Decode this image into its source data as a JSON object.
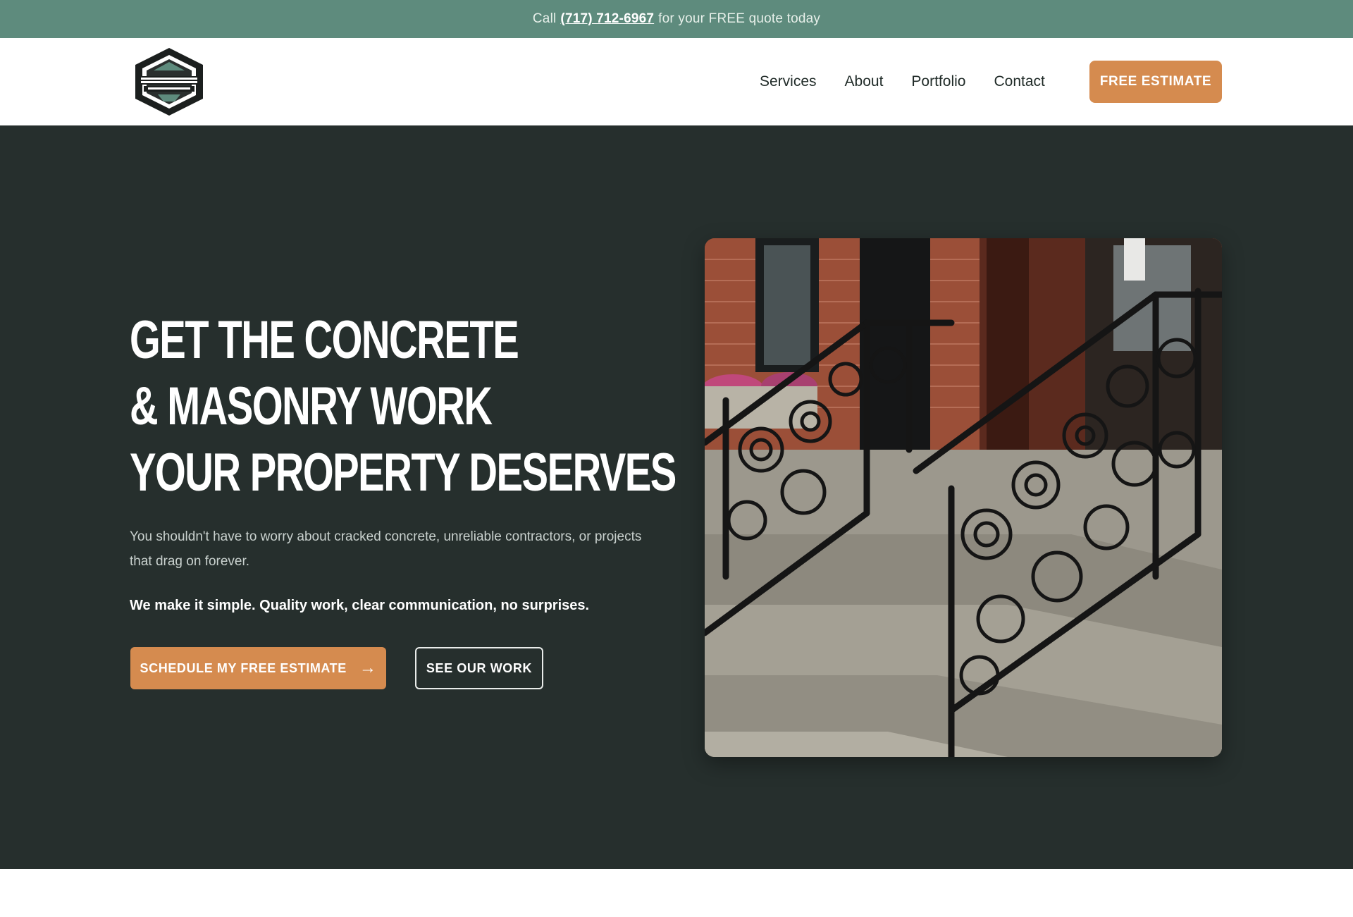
{
  "topbar": {
    "prefix": "Call",
    "phone": "(717) 712-6967",
    "suffix": "for your FREE quote today"
  },
  "nav": {
    "logo_alt": "Company logo",
    "links": [
      "Services",
      "About",
      "Portfolio",
      "Contact"
    ],
    "cta": "FREE ESTIMATE"
  },
  "hero": {
    "headline": [
      "GET THE CONCRETE",
      "& MASONRY WORK",
      "YOUR PROPERTY DESERVES"
    ],
    "body": "You shouldn't have to worry about cracked concrete, unreliable contractors, or projects that drag on forever.",
    "emphasis": "We make it simple. Quality work, clear communication, no surprises.",
    "primary_button": "SCHEDULE MY FREE ESTIMATE",
    "secondary_button": "SEE OUR WORK",
    "image_alt": "Concrete steps with ornate black wrought-iron railings in front of a brick building"
  },
  "colors": {
    "topbar": "#5e8b7d",
    "hero_bg": "#262f2d",
    "accent": "#d58b4f",
    "nav_text": "#1f2a27"
  },
  "icons": {
    "logo": "hexagon-logo-icon",
    "button_arrow": "arrow-right-icon"
  }
}
